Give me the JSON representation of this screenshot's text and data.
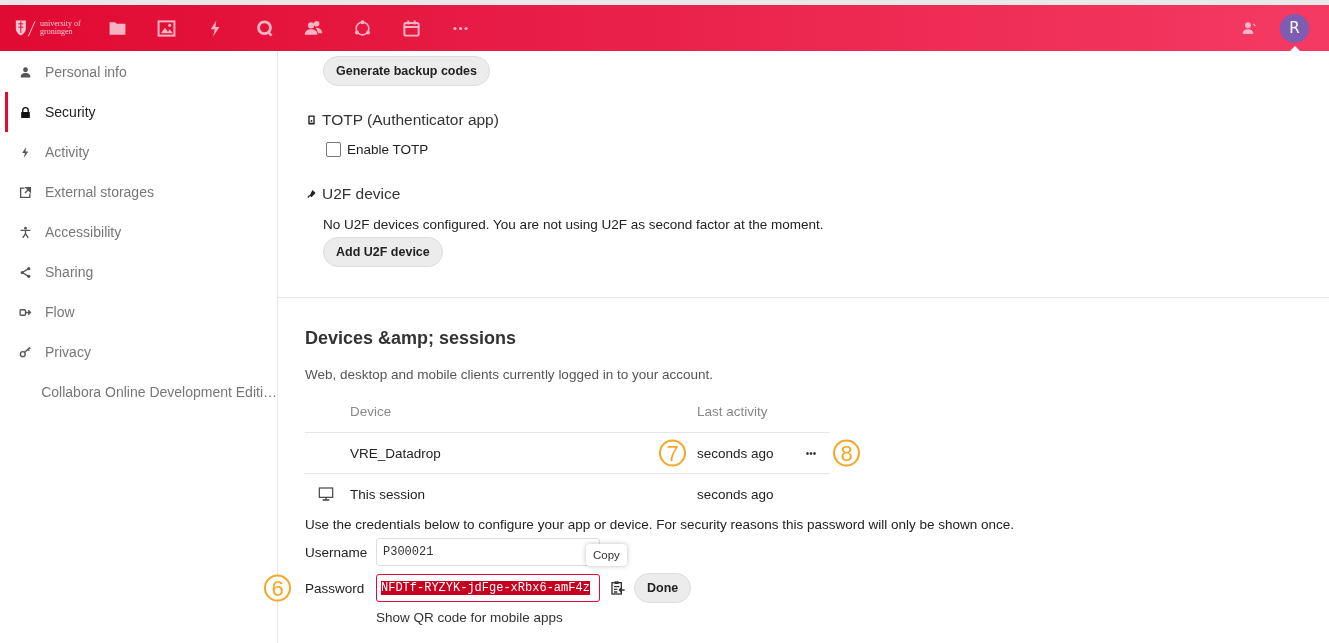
{
  "header": {
    "logo_text": [
      "university of",
      "groningen"
    ],
    "avatar": "R"
  },
  "sidebar": {
    "items": [
      {
        "label": "Personal info",
        "selected": false
      },
      {
        "label": "Security",
        "selected": true
      },
      {
        "label": "Activity",
        "selected": false
      },
      {
        "label": "External storages",
        "selected": false
      },
      {
        "label": "Accessibility",
        "selected": false
      },
      {
        "label": "Sharing",
        "selected": false
      },
      {
        "label": "Flow",
        "selected": false
      },
      {
        "label": "Privacy",
        "selected": false
      },
      {
        "label": "Collabora Online Development Editi…",
        "selected": false
      }
    ]
  },
  "two_factor": {
    "backup_button": "Generate backup codes",
    "totp": {
      "title": "TOTP (Authenticator app)",
      "checkbox": {
        "label": "Enable TOTP",
        "checked": false
      }
    },
    "u2f": {
      "title": "U2F device",
      "text": "No U2F devices configured. You are not using U2F as second factor at the moment.",
      "button": "Add U2F device"
    }
  },
  "sessions": {
    "title": "Devices &amp; sessions",
    "subtitle": "Web, desktop and mobile clients currently logged in to your account.",
    "columns": [
      "Device",
      "Last activity"
    ],
    "rows": [
      {
        "device": "VRE_Datadrop",
        "activity": "seconds ago",
        "menu": "•••"
      },
      {
        "device": "This session",
        "activity": "seconds ago"
      }
    ],
    "credentials": {
      "text": "Use the credentials below to configure your app or device. For security reasons this password will only be shown once.",
      "username_label": "Username",
      "username": "P300021",
      "password_label": "Password",
      "password": "NFDTf-RYZYK-jdFge-xRbx6-amF4z",
      "password_selected": true,
      "tooltip": "Copy",
      "done_button": "Done",
      "qr_link": "Show QR code for mobile apps"
    }
  },
  "callouts": [
    "6",
    "7",
    "8"
  ]
}
